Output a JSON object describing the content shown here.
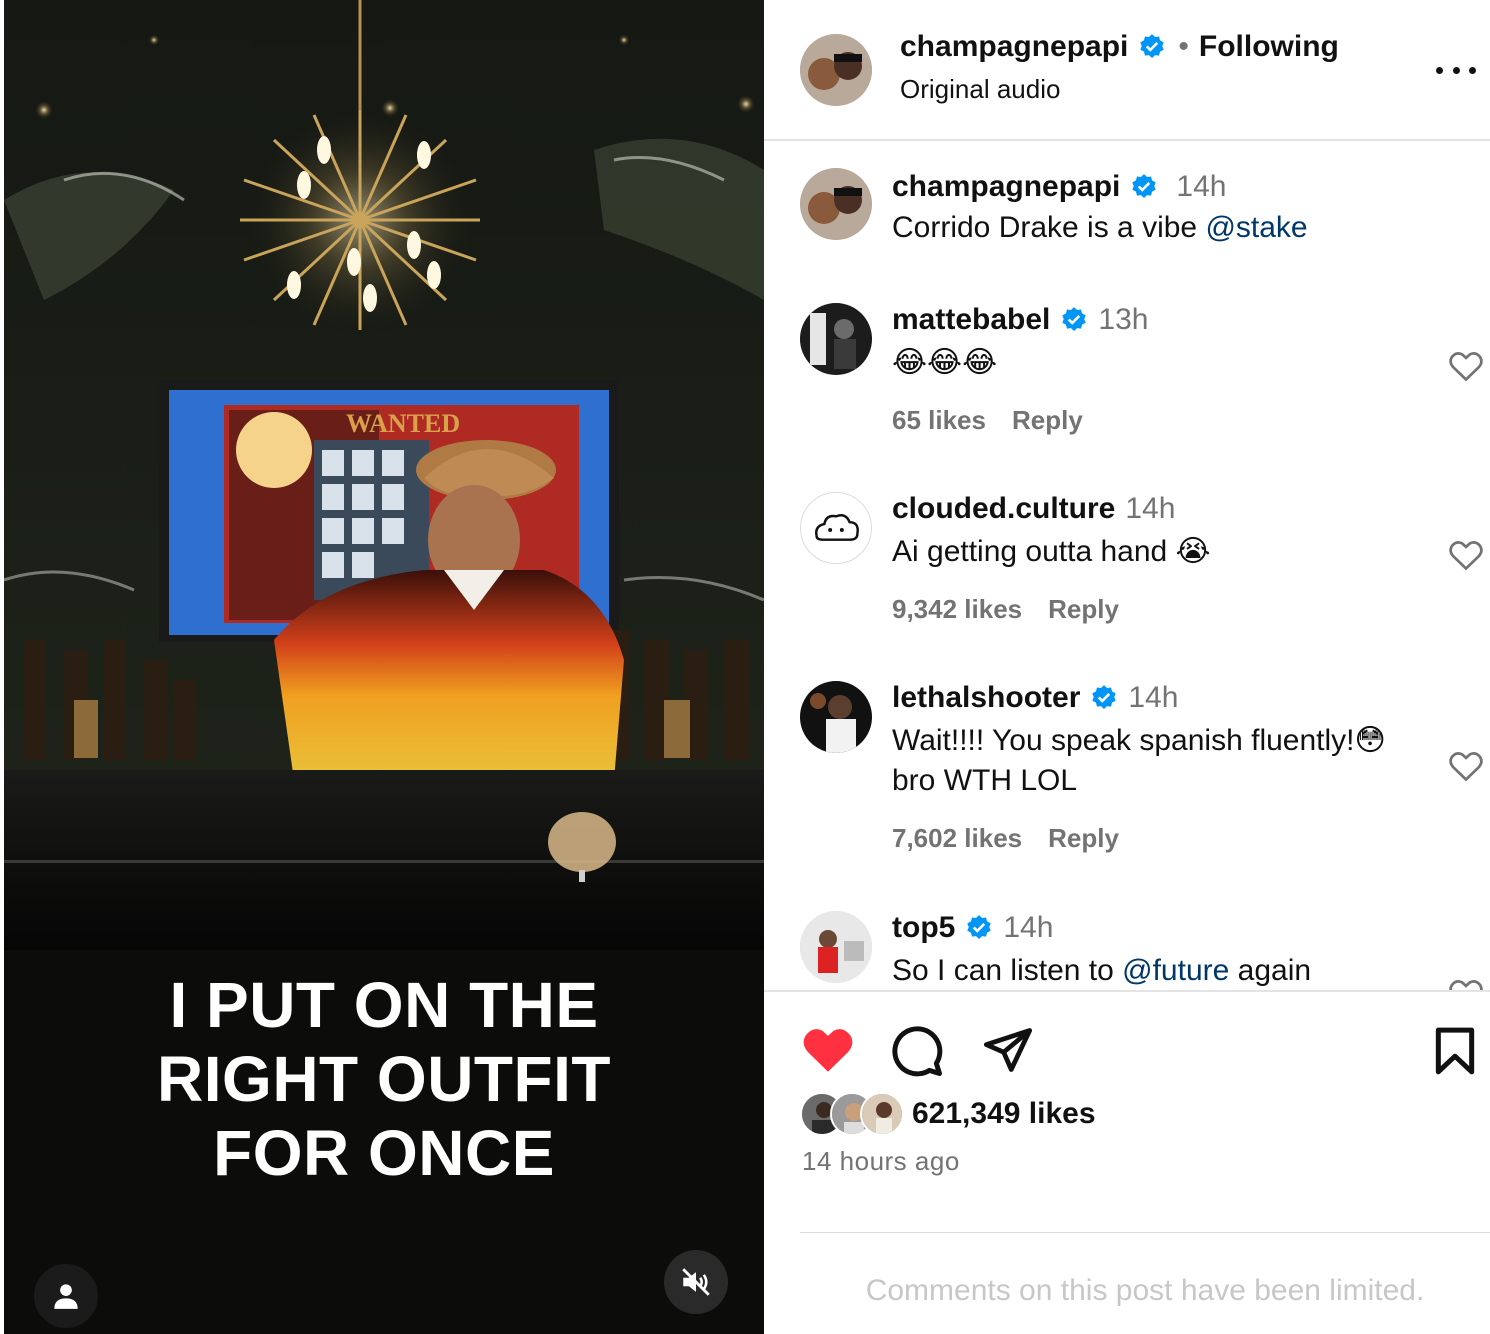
{
  "video": {
    "caption_lines": [
      "I PUT ON THE",
      "RIGHT OUTFIT",
      "FOR ONCE"
    ],
    "icons": {
      "user_tag": "user-icon",
      "audio": "speaker-muted-icon"
    },
    "screen_text": "WANTED"
  },
  "header": {
    "username": "champagnepapi",
    "separator": "•",
    "follow_status": "Following",
    "subtitle": "Original audio",
    "more_icon": "more-horizontal-icon"
  },
  "comments": [
    {
      "username": "champagnepapi",
      "verified": true,
      "time": "14h",
      "text": "Corrido Drake is a vibe ",
      "mention": "@stake",
      "text_after": "",
      "likes": "",
      "reply": ""
    },
    {
      "username": "mattebabel",
      "verified": true,
      "time": "13h",
      "text": "😂😂😂",
      "mention": "",
      "text_after": "",
      "likes": "65 likes",
      "reply": "Reply"
    },
    {
      "username": "clouded.culture",
      "verified": false,
      "time": "14h",
      "text": "Ai getting outta hand 😭",
      "mention": "",
      "text_after": "",
      "likes": "9,342 likes",
      "reply": "Reply"
    },
    {
      "username": "lethalshooter",
      "verified": true,
      "time": "14h",
      "text": "Wait!!!! You speak spanish fluently!😳 bro WTH LOL",
      "mention": "",
      "text_after": "",
      "likes": "7,602 likes",
      "reply": "Reply"
    },
    {
      "username": "top5",
      "verified": true,
      "time": "14h",
      "text": "So I can listen to ",
      "mention": "@future",
      "text_after": " again",
      "likes": "",
      "reply": ""
    }
  ],
  "actions": {
    "like_icon": "heart-filled-icon",
    "comment_icon": "comment-icon",
    "share_icon": "send-icon",
    "save_icon": "bookmark-icon"
  },
  "likes_summary": "621,349 likes",
  "posted_ago": "14 hours ago",
  "comments_limited": "Comments on this post have been limited.",
  "colors": {
    "like_red": "#ff3040",
    "verified_blue": "#0095f6",
    "mention_blue": "#00376b",
    "muted_gray": "#737373"
  }
}
